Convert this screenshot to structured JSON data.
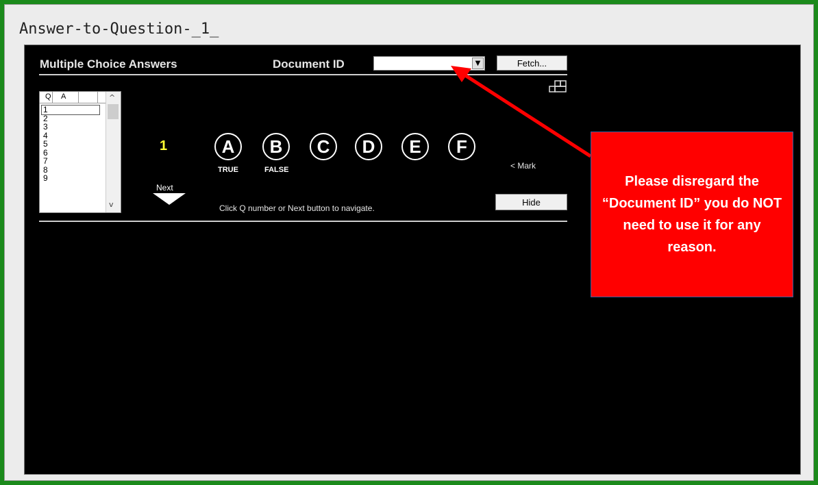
{
  "window": {
    "title": "Answer-to-Question-_1_"
  },
  "header": {
    "section_title": "Multiple Choice Answers",
    "document_id_label": "Document ID",
    "document_id_value": "",
    "fetch_label": "Fetch..."
  },
  "question_list": {
    "col_q": "Q",
    "col_a": "A",
    "rows": [
      "1",
      "2",
      "3",
      "4",
      "5",
      "6",
      "7",
      "8",
      "9"
    ],
    "selected": "1"
  },
  "question": {
    "number": "1",
    "choices": [
      "A",
      "B",
      "C",
      "D",
      "E",
      "F"
    ],
    "choice_a_sub": "TRUE",
    "choice_b_sub": "FALSE",
    "mark_label": "< Mark",
    "next_label": "Next",
    "hint": "Click Q number or Next button to navigate.",
    "hide_label": "Hide"
  },
  "callout": {
    "text": "Please disregard the “Document ID” you do NOT need to use it for any reason.",
    "color": "#ff0000"
  },
  "colors": {
    "frame": "#1b8a1b",
    "panel": "#000000",
    "qnum": "#ffff33"
  }
}
